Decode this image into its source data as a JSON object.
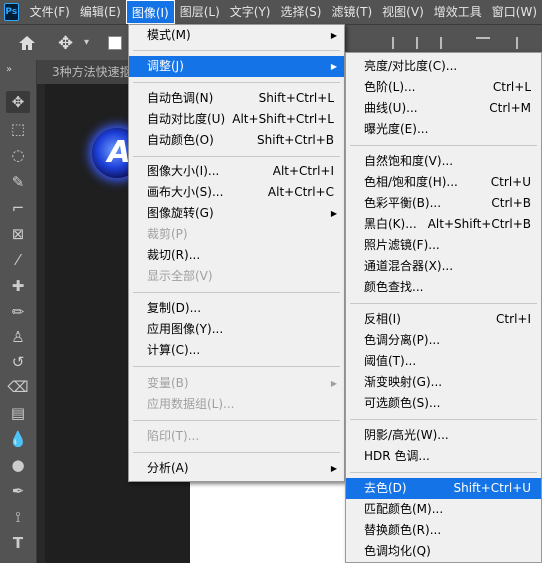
{
  "menubar": {
    "logo": "Ps",
    "items": [
      "文件(F)",
      "编辑(E)",
      "图像(I)",
      "图层(L)",
      "文字(Y)",
      "选择(S)",
      "滤镜(T)",
      "视图(V)",
      "增效工具",
      "窗口(W)"
    ],
    "active_index": 2
  },
  "toolbar": {
    "icons": [
      "home-icon",
      "move-icon",
      "chevron-down-icon",
      "checkbox-icon",
      "align-left-icon",
      "align-center-icon",
      "align-right-icon",
      "distribute-icon"
    ]
  },
  "tabs": {
    "collapse": "»",
    "doc_title": "3种方法快速抠"
  },
  "image_menu": {
    "items": [
      {
        "label": "模式(M)",
        "submenu": true
      },
      {
        "label": "调整(J)",
        "submenu": true,
        "highlighted": true
      },
      {
        "label": "自动色调(N)",
        "shortcut": "Shift+Ctrl+L"
      },
      {
        "label": "自动对比度(U)",
        "shortcut": "Alt+Shift+Ctrl+L"
      },
      {
        "label": "自动颜色(O)",
        "shortcut": "Shift+Ctrl+B"
      },
      {
        "label": "图像大小(I)...",
        "shortcut": "Alt+Ctrl+I"
      },
      {
        "label": "画布大小(S)...",
        "shortcut": "Alt+Ctrl+C"
      },
      {
        "label": "图像旋转(G)",
        "submenu": true
      },
      {
        "label": "裁剪(P)",
        "disabled": true
      },
      {
        "label": "裁切(R)..."
      },
      {
        "label": "显示全部(V)",
        "disabled": true
      },
      {
        "label": "复制(D)..."
      },
      {
        "label": "应用图像(Y)..."
      },
      {
        "label": "计算(C)..."
      },
      {
        "label": "变量(B)",
        "submenu": true,
        "disabled": true
      },
      {
        "label": "应用数据组(L)...",
        "disabled": true
      },
      {
        "label": "陷印(T)...",
        "disabled": true
      },
      {
        "label": "分析(A)",
        "submenu": true
      }
    ]
  },
  "adjust_menu": {
    "items": [
      {
        "label": "亮度/对比度(C)..."
      },
      {
        "label": "色阶(L)...",
        "shortcut": "Ctrl+L"
      },
      {
        "label": "曲线(U)...",
        "shortcut": "Ctrl+M"
      },
      {
        "label": "曝光度(E)..."
      },
      {
        "label": "自然饱和度(V)..."
      },
      {
        "label": "色相/饱和度(H)...",
        "shortcut": "Ctrl+U"
      },
      {
        "label": "色彩平衡(B)...",
        "shortcut": "Ctrl+B"
      },
      {
        "label": "黑白(K)...",
        "shortcut": "Alt+Shift+Ctrl+B"
      },
      {
        "label": "照片滤镜(F)..."
      },
      {
        "label": "通道混合器(X)..."
      },
      {
        "label": "颜色查找..."
      },
      {
        "label": "反相(I)",
        "shortcut": "Ctrl+I"
      },
      {
        "label": "色调分离(P)..."
      },
      {
        "label": "阈值(T)..."
      },
      {
        "label": "渐变映射(G)..."
      },
      {
        "label": "可选颜色(S)..."
      },
      {
        "label": "阴影/高光(W)..."
      },
      {
        "label": "HDR 色调..."
      },
      {
        "label": "去色(D)",
        "shortcut": "Shift+Ctrl+U",
        "highlighted": true
      },
      {
        "label": "匹配颜色(M)..."
      },
      {
        "label": "替换颜色(R)..."
      },
      {
        "label": "色调均化(Q)"
      }
    ]
  },
  "colors": {
    "accent": "#1473e6",
    "menu_bg": "#f0f0f0",
    "chrome": "#535353"
  }
}
